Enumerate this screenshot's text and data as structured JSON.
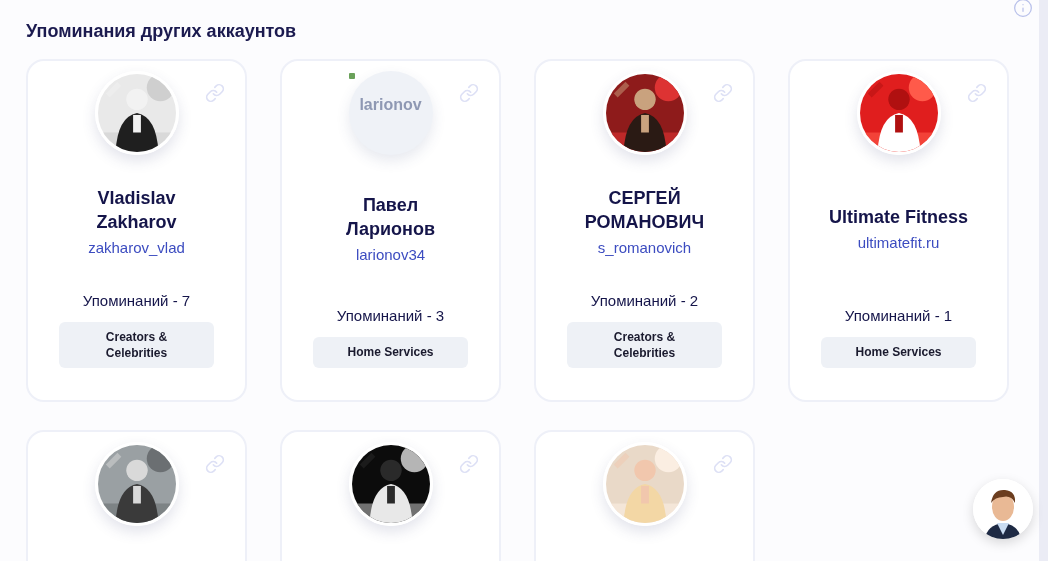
{
  "section_title": "Упоминания других аккаунтов",
  "cards": [
    {
      "avatar": {
        "kind": "picture"
      },
      "name_lines": [
        "Vladislav",
        "Zakharov"
      ],
      "handle": "zakharov_vlad",
      "mentions": "Упоминаний - 7",
      "category": "Creators & Celebrities"
    },
    {
      "avatar": {
        "kind": "broken",
        "alt": "larionov"
      },
      "name_lines": [
        "Павел",
        "Ларионов"
      ],
      "handle": "larionov34",
      "mentions": "Упоминаний - 3",
      "category": "Home Services"
    },
    {
      "avatar": {
        "kind": "picture"
      },
      "name_lines": [
        "СЕРГЕЙ",
        "РОМАНОВИЧ"
      ],
      "handle": "s_romanovich",
      "mentions": "Упоминаний - 2",
      "category": "Creators & Celebrities"
    },
    {
      "avatar": {
        "kind": "picture"
      },
      "name_lines": [
        "Ultimate Fitness"
      ],
      "handle": "ultimatefit.ru",
      "mentions": "Упоминаний - 1",
      "category": "Home Services"
    },
    {
      "avatar": {
        "kind": "picture"
      }
    },
    {
      "avatar": {
        "kind": "picture"
      }
    },
    {
      "avatar": {
        "kind": "picture"
      }
    }
  ]
}
